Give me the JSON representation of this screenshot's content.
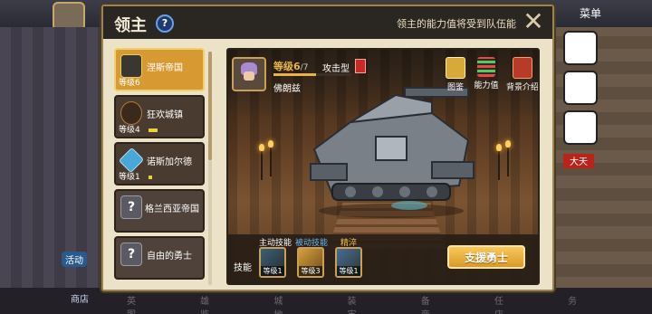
{
  "background": {
    "menu_label": "菜单",
    "shop_label": "商店",
    "activity_label": "活动",
    "red_tag": "大天",
    "tabs": "英 雄 城 装 备 任 务 图 鉴 地 牢 商 店"
  },
  "dialog": {
    "title": "领主",
    "help": "?",
    "note": "领主的能力值将受到队伍能",
    "close": "✕"
  },
  "lords": [
    {
      "name": "涅斯帝国",
      "level": "等级6",
      "emblem": "shield-icon",
      "selected": true
    },
    {
      "name": "狂欢城镇",
      "level": "等级4",
      "emblem": "jester-icon"
    },
    {
      "name": "诺斯加尔德",
      "level": "等级1",
      "emblem": "crystal-icon"
    },
    {
      "name": "格兰西亚帝国",
      "level": "",
      "emblem": "question-icon"
    },
    {
      "name": "自由的勇士",
      "level": "",
      "emblem": "question-icon"
    }
  ],
  "detail": {
    "level_text": "等级6",
    "level_max": "/7",
    "level_progress": 0.55,
    "type": "攻击型",
    "name": "佛朗兹",
    "buttons": [
      {
        "label": "图鉴",
        "icon": "book-icon"
      },
      {
        "label": "能力值",
        "icon": "stats-icon"
      },
      {
        "label": "背景介绍",
        "icon": "scroll-icon"
      }
    ],
    "skills": {
      "label": "技能",
      "active": "主动技能",
      "passive": "被动技能",
      "refine": "精淬",
      "slots": [
        {
          "level": "等级1"
        },
        {
          "level": "等级3"
        },
        {
          "level": "等级1"
        }
      ]
    },
    "support_button": "支援勇士"
  },
  "colors": {
    "accent": "#d79a32",
    "panel": "#ebe2c8",
    "header": "#2a2622",
    "passive": "#6ab8f0",
    "refine": "#f2c64a"
  }
}
